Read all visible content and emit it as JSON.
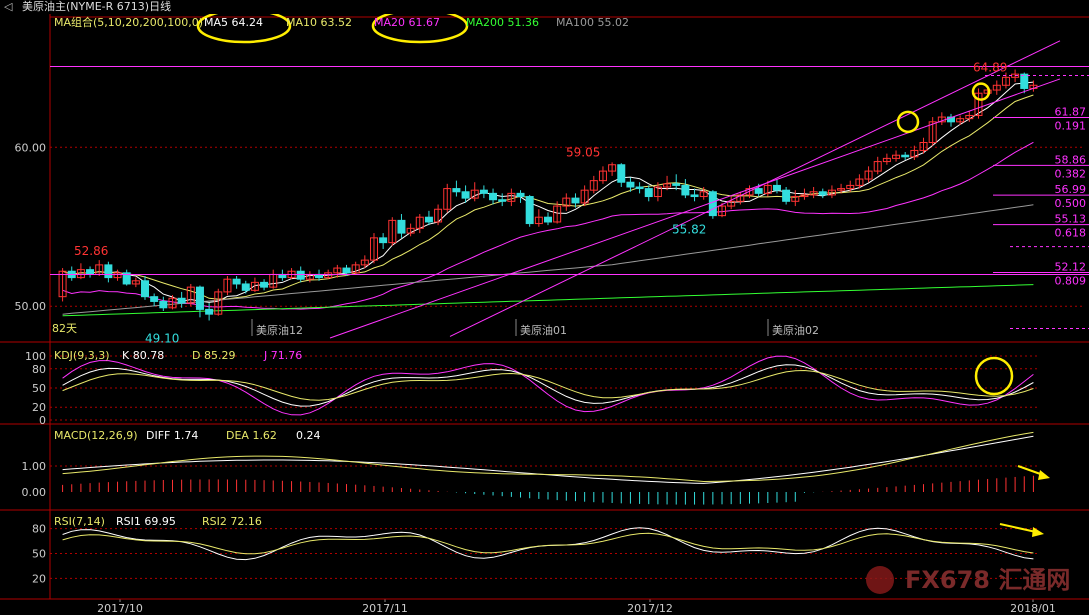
{
  "window": {
    "title": "美原油主(NYME-R 6713)日线",
    "back_icon": "left-arrow-icon"
  },
  "price_panel": {
    "ma_header": [
      {
        "text": "MA组合(5,10,20,200,100,0)",
        "color": "#e8e86a"
      },
      {
        "text": "MA5 64.24",
        "color": "#ffffff"
      },
      {
        "text": "MA10 63.52",
        "color": "#e8e86a"
      },
      {
        "text": "MA20 61.67",
        "color": "#ff33ff"
      },
      {
        "text": "MA200 51.36",
        "color": "#33ff33"
      },
      {
        "text": "MA100 55.02",
        "color": "#999999"
      }
    ],
    "y_ticks": [
      "60.00",
      "50.00"
    ],
    "price_labels": [
      "52.86",
      "49.10",
      "59.05",
      "55.82",
      "64.89"
    ],
    "day_count": "82天",
    "contract_labels": [
      "美原油12",
      "美原油01",
      "美原油02"
    ],
    "fib_levels": [
      {
        "price": "61.87",
        "ratio": "0.191"
      },
      {
        "price": "58.86",
        "ratio": "0.382"
      },
      {
        "price": "56.99",
        "ratio": "0.500"
      },
      {
        "price": "55.13",
        "ratio": "0.618"
      },
      {
        "price": "52.12",
        "ratio": "0.809"
      }
    ]
  },
  "kdj_panel": {
    "header": [
      {
        "text": "KDJ(9,3,3)",
        "color": "#e8e86a"
      },
      {
        "text": "K  80.78",
        "color": "#ffffff"
      },
      {
        "text": "D  85.29",
        "color": "#e8e86a"
      },
      {
        "text": "J  71.76",
        "color": "#ff33ff"
      }
    ],
    "y_ticks": [
      "100",
      "80",
      "50",
      "20",
      "0"
    ]
  },
  "macd_panel": {
    "header": [
      {
        "text": "MACD(12,26,9)",
        "color": "#e8e86a"
      },
      {
        "text": "DIFF  1.74",
        "color": "#ffffff"
      },
      {
        "text": "DEA  1.62",
        "color": "#e8e86a"
      },
      {
        "text": "0.24",
        "color": "#ffffff"
      }
    ],
    "y_ticks": [
      "1.00",
      "0.00"
    ]
  },
  "rsi_panel": {
    "header": [
      {
        "text": "RSI(7,14)",
        "color": "#e8e86a"
      },
      {
        "text": "RSI1  69.95",
        "color": "#ffffff"
      },
      {
        "text": "RSI2  72.16",
        "color": "#e8e86a"
      }
    ],
    "y_ticks": [
      "80",
      "50",
      "20"
    ]
  },
  "x_axis": {
    "labels": [
      "2017/10",
      "2017/11",
      "2017/12",
      "2018/01"
    ]
  },
  "watermark": {
    "text": "FX678 汇通网"
  },
  "colors": {
    "up": "#ff3333",
    "down": "#33dddd",
    "grid": "#b00000",
    "ma5": "#ffffff",
    "ma10": "#e8e86a",
    "ma20": "#ff33ff",
    "ma100": "#999999",
    "ma200": "#33ff33",
    "annotation": "#ffee00"
  },
  "chart_data": {
    "type": "candlestick",
    "series_name": "美原油主(NYME-R 6713)日线",
    "ylim": [
      48,
      67
    ],
    "candles": [
      [
        50.6,
        52.2,
        50.3,
        52.4
      ],
      [
        52.2,
        51.8,
        51.6,
        52.5
      ],
      [
        51.8,
        52.3,
        51.7,
        52.7
      ],
      [
        52.3,
        52.0,
        51.8,
        52.5
      ],
      [
        52.0,
        52.6,
        51.9,
        52.9
      ],
      [
        52.6,
        51.8,
        51.5,
        52.8
      ],
      [
        51.8,
        52.1,
        51.6,
        52.3
      ],
      [
        52.1,
        51.4,
        51.3,
        52.3
      ],
      [
        51.4,
        51.6,
        51.2,
        51.8
      ],
      [
        51.6,
        50.6,
        50.4,
        51.9
      ],
      [
        50.6,
        50.3,
        50.0,
        50.8
      ],
      [
        50.3,
        49.9,
        49.7,
        50.6
      ],
      [
        49.9,
        50.5,
        49.8,
        50.7
      ],
      [
        50.5,
        50.2,
        49.9,
        50.9
      ],
      [
        50.2,
        51.2,
        50.0,
        51.4
      ],
      [
        51.2,
        49.8,
        49.3,
        51.3
      ],
      [
        49.8,
        49.5,
        49.1,
        50.2
      ],
      [
        49.5,
        50.9,
        49.4,
        51.1
      ],
      [
        50.9,
        51.7,
        50.7,
        51.9
      ],
      [
        51.7,
        51.4,
        51.1,
        51.9
      ],
      [
        51.4,
        51.0,
        50.8,
        51.6
      ],
      [
        51.0,
        51.5,
        50.9,
        51.8
      ],
      [
        51.5,
        51.2,
        51.0,
        51.7
      ],
      [
        51.2,
        52.0,
        51.1,
        52.3
      ],
      [
        52.0,
        51.8,
        51.6,
        52.3
      ],
      [
        51.8,
        52.2,
        51.7,
        52.4
      ],
      [
        52.2,
        51.7,
        51.5,
        52.5
      ],
      [
        51.7,
        52.0,
        51.5,
        52.2
      ],
      [
        52.0,
        51.8,
        51.6,
        52.3
      ],
      [
        51.8,
        52.1,
        51.7,
        52.3
      ],
      [
        52.1,
        52.4,
        51.8,
        52.6
      ],
      [
        52.4,
        52.1,
        51.9,
        52.6
      ],
      [
        52.1,
        52.6,
        52.0,
        52.8
      ],
      [
        52.6,
        52.9,
        52.4,
        53.2
      ],
      [
        52.9,
        54.3,
        52.7,
        54.6
      ],
      [
        54.3,
        54.0,
        53.6,
        54.6
      ],
      [
        54.0,
        55.4,
        53.8,
        55.6
      ],
      [
        55.4,
        54.6,
        54.3,
        55.8
      ],
      [
        54.6,
        54.9,
        54.4,
        55.2
      ],
      [
        54.9,
        55.6,
        54.6,
        55.8
      ],
      [
        55.6,
        55.3,
        55.1,
        56.0
      ],
      [
        55.3,
        56.1,
        55.1,
        56.4
      ],
      [
        56.1,
        57.4,
        55.9,
        57.7
      ],
      [
        57.4,
        57.2,
        56.9,
        57.9
      ],
      [
        57.2,
        56.8,
        56.5,
        57.6
      ],
      [
        56.8,
        57.3,
        56.6,
        57.8
      ],
      [
        57.3,
        57.1,
        56.8,
        57.6
      ],
      [
        57.1,
        56.7,
        56.4,
        57.4
      ],
      [
        56.7,
        56.6,
        56.3,
        57.1
      ],
      [
        56.6,
        57.1,
        56.3,
        57.4
      ],
      [
        57.1,
        56.9,
        56.5,
        57.3
      ],
      [
        56.9,
        55.2,
        55.0,
        57.0
      ],
      [
        55.2,
        55.6,
        55.0,
        56.1
      ],
      [
        55.6,
        55.3,
        55.1,
        55.9
      ],
      [
        55.3,
        56.3,
        55.2,
        56.6
      ],
      [
        56.3,
        56.8,
        56.0,
        57.1
      ],
      [
        56.8,
        56.5,
        56.2,
        57.1
      ],
      [
        56.5,
        57.3,
        56.3,
        57.6
      ],
      [
        57.3,
        57.9,
        57.1,
        58.2
      ],
      [
        57.9,
        58.5,
        57.7,
        58.8
      ],
      [
        58.5,
        58.9,
        58.2,
        59.05
      ],
      [
        58.9,
        57.8,
        57.5,
        59.0
      ],
      [
        57.8,
        57.5,
        57.2,
        58.1
      ],
      [
        57.5,
        57.4,
        57.1,
        57.8
      ],
      [
        57.4,
        56.9,
        56.6,
        57.6
      ],
      [
        56.9,
        57.5,
        56.6,
        57.8
      ],
      [
        57.5,
        57.7,
        57.3,
        58.2
      ],
      [
        57.7,
        57.6,
        57.3,
        58.3
      ],
      [
        57.6,
        57.0,
        56.8,
        58.0
      ],
      [
        57.0,
        56.9,
        56.6,
        57.4
      ],
      [
        56.9,
        57.2,
        56.7,
        57.5
      ],
      [
        57.2,
        55.7,
        55.5,
        57.3
      ],
      [
        55.7,
        56.3,
        55.6,
        56.5
      ],
      [
        56.3,
        56.6,
        56.1,
        56.9
      ],
      [
        56.6,
        57.0,
        56.4,
        57.2
      ],
      [
        57.0,
        57.4,
        56.8,
        57.6
      ],
      [
        57.4,
        57.1,
        56.9,
        57.7
      ],
      [
        57.1,
        57.6,
        56.9,
        57.9
      ],
      [
        57.6,
        57.3,
        57.1,
        58.0
      ],
      [
        57.3,
        56.6,
        56.4,
        57.5
      ],
      [
        56.6,
        56.9,
        56.3,
        57.3
      ],
      [
        56.9,
        57.0,
        56.7,
        57.4
      ],
      [
        57.0,
        57.2,
        56.8,
        57.5
      ],
      [
        57.2,
        57.0,
        56.8,
        57.4
      ],
      [
        57.0,
        57.3,
        56.8,
        57.6
      ],
      [
        57.3,
        57.4,
        57.1,
        57.7
      ],
      [
        57.4,
        57.6,
        57.2,
        57.9
      ],
      [
        57.6,
        58.0,
        57.4,
        58.3
      ],
      [
        58.0,
        58.5,
        57.8,
        58.8
      ],
      [
        58.5,
        59.1,
        58.3,
        59.4
      ],
      [
        59.1,
        59.3,
        58.9,
        59.6
      ],
      [
        59.3,
        59.5,
        59.1,
        59.8
      ],
      [
        59.5,
        59.4,
        59.2,
        59.7
      ],
      [
        59.4,
        59.8,
        59.2,
        60.1
      ],
      [
        59.8,
        60.3,
        59.6,
        60.6
      ],
      [
        60.3,
        61.6,
        60.1,
        61.9
      ],
      [
        61.6,
        61.9,
        61.4,
        62.2
      ],
      [
        61.9,
        61.6,
        61.3,
        62.1
      ],
      [
        61.6,
        61.8,
        61.4,
        62.0
      ],
      [
        61.8,
        62.0,
        61.6,
        62.3
      ],
      [
        62.0,
        63.4,
        61.8,
        63.7
      ],
      [
        63.4,
        63.6,
        63.1,
        63.9
      ],
      [
        63.6,
        63.9,
        63.3,
        64.2
      ],
      [
        63.9,
        64.4,
        63.7,
        64.7
      ],
      [
        64.4,
        64.6,
        64.1,
        64.89
      ],
      [
        64.6,
        63.7,
        63.4,
        64.7
      ],
      [
        63.7,
        63.9,
        63.5,
        64.2
      ]
    ],
    "ma5_last": 64.24,
    "ma10_last": 63.52,
    "ma20_last": 61.67,
    "ma200_last": 51.36,
    "ma100_last": 55.02,
    "kdj_last": {
      "K": 80.78,
      "D": 85.29,
      "J": 71.76
    },
    "macd_last": {
      "DIFF": 1.74,
      "DEA": 1.62,
      "MACD": 0.24
    },
    "rsi_last": {
      "RSI1": 69.95,
      "RSI2": 72.16
    }
  }
}
